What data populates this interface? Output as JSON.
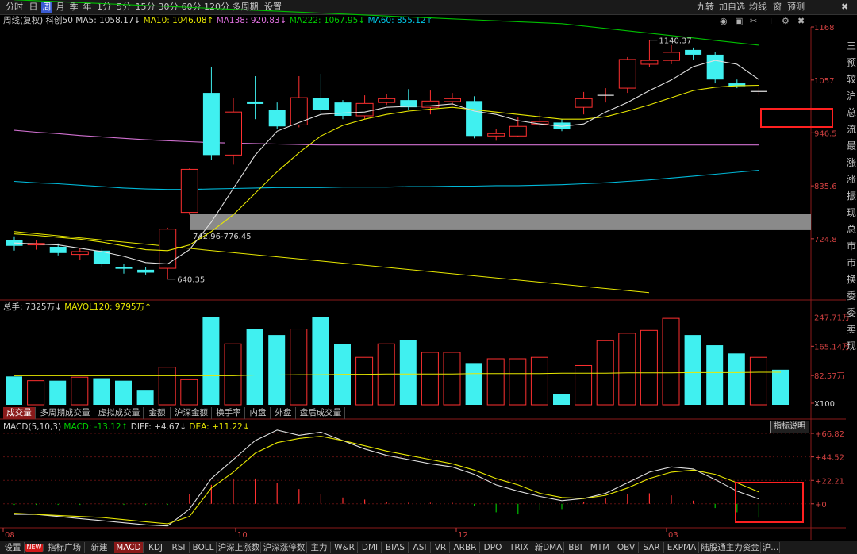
{
  "toolbar": {
    "periods": [
      "分时",
      "日",
      "周",
      "月",
      "季",
      "年",
      "1分",
      "5分",
      "15分",
      "30分",
      "60分",
      "120分",
      "多周期",
      "设置"
    ],
    "selected": "周",
    "right_items": [
      "九转",
      "加自选",
      "均线",
      "窗",
      "预测"
    ]
  },
  "kline_info": {
    "period": "周线(复权)",
    "name": "科创50",
    "ma5": "MA5: 1058.17↓",
    "ma10": "MA10: 1046.08↑",
    "ma138": "MA138: 920.83↓",
    "ma222": "MA222: 1067.95↓",
    "ma60": "MA60: 855.12↑"
  },
  "volume_info": {
    "total": "总手: 7325万↓",
    "mavol": "MAVOL120: 9795万↑"
  },
  "macd_info": {
    "name": "MACD(5,10,3)",
    "macd": "MACD: -13.12↑",
    "diff": "DIFF: +4.67↓",
    "dea": "DEA: +11.22↓"
  },
  "macd_button": "指标说明",
  "sub_tabs": [
    "成交量",
    "多周期成交量",
    "虚拟成交量",
    "金额",
    "沪深金额",
    "换手率",
    "内盘",
    "外盘",
    "盘后成交量"
  ],
  "sub_tab_selected": "成交量",
  "bottom_tabs": [
    "设置",
    "NEW",
    "指标广场",
    "新建",
    "MACD",
    "KDJ",
    "RSI",
    "BOLL",
    "沪深上涨数",
    "沪深涨停数",
    "主力",
    "W&R",
    "DMI",
    "BIAS",
    "ASI",
    "VR",
    "ARBR",
    "DPO",
    "TRIX",
    "新DMA",
    "BBI",
    "MTM",
    "OBV",
    "SAR",
    "EXPMA",
    "陆股通主力资金",
    "沪..."
  ],
  "bottom_selected": "MACD",
  "right_column": [
    "三",
    "预",
    "较",
    "沪",
    "总",
    "流",
    "最",
    "涨",
    "涨",
    "振",
    "现",
    "总",
    "市",
    "市",
    "换",
    "委",
    "委",
    "卖",
    "现"
  ],
  "colors": {
    "up": "#ff3030",
    "down": "#40f0f0",
    "ma5": "#e0e0e0",
    "ma10": "#e8e800",
    "ma138": "#d070d0",
    "ma222": "#00c000",
    "ma60": "#00b8d8",
    "bg": "#000000"
  },
  "chart_data": [
    {
      "type": "candlestick",
      "x_labels": [
        "08",
        "10",
        "12",
        "03"
      ],
      "y_ticks": [
        "1168",
        "1057",
        "946.5",
        "835.6",
        "724.8"
      ],
      "annotations": {
        "high": "1140.37",
        "low": "640.35",
        "range": "742.96-776.45"
      },
      "candles": [
        {
          "o": 722,
          "c": 710,
          "h": 730,
          "l": 700
        },
        {
          "o": 712,
          "c": 715,
          "h": 722,
          "l": 702
        },
        {
          "o": 708,
          "c": 695,
          "h": 715,
          "l": 690
        },
        {
          "o": 692,
          "c": 698,
          "h": 705,
          "l": 680
        },
        {
          "o": 700,
          "c": 672,
          "h": 705,
          "l": 665
        },
        {
          "o": 665,
          "c": 662,
          "h": 672,
          "l": 652
        },
        {
          "o": 660,
          "c": 654,
          "h": 665,
          "l": 650
        },
        {
          "o": 663,
          "c": 745,
          "h": 748,
          "l": 640.35
        },
        {
          "o": 780,
          "c": 870,
          "h": 872,
          "l": 775
        },
        {
          "o": 1030,
          "c": 900,
          "h": 1085,
          "l": 890
        },
        {
          "o": 900,
          "c": 990,
          "h": 1020,
          "l": 880
        },
        {
          "o": 1012,
          "c": 1007,
          "h": 1065,
          "l": 975
        },
        {
          "o": 995,
          "c": 960,
          "h": 1010,
          "l": 955
        },
        {
          "o": 963,
          "c": 1020,
          "h": 1065,
          "l": 958
        },
        {
          "o": 1020,
          "c": 995,
          "h": 1070,
          "l": 985
        },
        {
          "o": 1010,
          "c": 982,
          "h": 1015,
          "l": 975
        },
        {
          "o": 982,
          "c": 1008,
          "h": 1025,
          "l": 975
        },
        {
          "o": 1010,
          "c": 1018,
          "h": 1028,
          "l": 1005
        },
        {
          "o": 1015,
          "c": 1000,
          "h": 1038,
          "l": 995
        },
        {
          "o": 1000,
          "c": 1013,
          "h": 1035,
          "l": 985
        },
        {
          "o": 1012,
          "c": 1018,
          "h": 1030,
          "l": 1005
        },
        {
          "o": 1013,
          "c": 940,
          "h": 1023,
          "l": 935
        },
        {
          "o": 940,
          "c": 945,
          "h": 955,
          "l": 930
        },
        {
          "o": 940,
          "c": 960,
          "h": 980,
          "l": 938
        },
        {
          "o": 965,
          "c": 970,
          "h": 990,
          "l": 958
        },
        {
          "o": 968,
          "c": 955,
          "h": 975,
          "l": 950
        },
        {
          "o": 1000,
          "c": 1018,
          "h": 1032,
          "l": 985
        },
        {
          "o": 1025,
          "c": 1025,
          "h": 1040,
          "l": 1010
        },
        {
          "o": 1040,
          "c": 1100,
          "h": 1105,
          "l": 1030
        },
        {
          "o": 1090,
          "c": 1098,
          "h": 1140.37,
          "l": 1085
        },
        {
          "o": 1098,
          "c": 1115,
          "h": 1130,
          "l": 1090
        },
        {
          "o": 1120,
          "c": 1110,
          "h": 1125,
          "l": 1100
        },
        {
          "o": 1110,
          "c": 1058,
          "h": 1115,
          "l": 1050
        },
        {
          "o": 1050,
          "c": 1044,
          "h": 1058,
          "l": 1040
        },
        {
          "o": 1033,
          "c": 1033,
          "h": 1043,
          "l": 1025
        }
      ],
      "ma5": [
        716,
        714,
        712,
        705,
        698,
        688,
        675,
        672,
        702,
        760,
        830,
        900,
        950,
        968,
        985,
        988,
        990,
        1000,
        1002,
        1003,
        1007,
        992,
        985,
        972,
        965,
        960,
        965,
        990,
        1010,
        1035,
        1057,
        1085,
        1098,
        1090,
        1058
      ],
      "ma10": [
        735,
        732,
        728,
        724,
        718,
        710,
        702,
        700,
        712,
        740,
        775,
        820,
        865,
        905,
        940,
        962,
        975,
        985,
        992,
        996,
        1000,
        995,
        990,
        985,
        980,
        975,
        975,
        980,
        992,
        1005,
        1020,
        1035,
        1042,
        1045,
        1046
      ],
      "ma138": [
        952,
        948,
        945,
        941,
        938,
        935,
        932,
        930,
        928,
        926,
        925,
        924,
        923,
        922,
        921,
        921,
        921,
        921,
        921,
        921,
        921,
        921,
        921,
        921,
        921,
        921,
        921,
        921,
        921,
        921,
        921,
        921,
        921,
        921,
        921
      ],
      "ma222": [
        1225,
        1223,
        1221,
        1219,
        1217,
        1215,
        1213,
        1211,
        1209,
        1207,
        1205,
        1203,
        1201,
        1199,
        1197,
        1195,
        1193,
        1191,
        1189,
        1187,
        1185,
        1183,
        1181,
        1179,
        1177,
        1175,
        1170,
        1165,
        1160,
        1155,
        1150,
        1145,
        1140,
        1135,
        1130
      ],
      "ma60": [
        845,
        842,
        840,
        837,
        834,
        831,
        829,
        828,
        828,
        829,
        830,
        831,
        832,
        832,
        832,
        833,
        833,
        833,
        834,
        834,
        835,
        835,
        836,
        836,
        837,
        838,
        840,
        842,
        845,
        848,
        852,
        856,
        860,
        864,
        868
      ],
      "dash_line": [
        [
          0,
          740
        ],
        [
          13.5,
          705
        ]
      ],
      "price_range": {
        "y_top": 1168,
        "y_bottom": 600
      }
    },
    {
      "type": "bar",
      "name": "volume",
      "y_ticks": [
        "247.71万",
        "165.14万",
        "82.57万",
        "X100"
      ],
      "values": [
        80,
        68,
        68,
        78,
        75,
        68,
        40,
        106,
        71,
        248,
        172,
        214,
        197,
        214,
        248,
        172,
        134,
        172,
        183,
        148,
        148,
        118,
        130,
        130,
        134,
        30,
        111,
        181,
        202,
        210,
        244,
        197,
        168,
        145,
        134,
        99
      ],
      "mavol": [
        82,
        82,
        82,
        82,
        82,
        82,
        82,
        82,
        82,
        82,
        82,
        84,
        84,
        85,
        85,
        86,
        86,
        87,
        87,
        87,
        87,
        88,
        88,
        88,
        88,
        89,
        89,
        89,
        90,
        90,
        90,
        91,
        91,
        91,
        92,
        92
      ],
      "ylim": [
        0,
        260
      ]
    },
    {
      "type": "line",
      "name": "MACD",
      "y_ticks": [
        "+66.82",
        "+44.52",
        "+22.21",
        "+0"
      ],
      "diff": [
        -10,
        -10,
        -12,
        -14,
        -16,
        -18,
        -20,
        -21,
        -5,
        24,
        42,
        60,
        70,
        65,
        68,
        60,
        52,
        46,
        42,
        38,
        35,
        28,
        18,
        12,
        7,
        3,
        5,
        10,
        20,
        30,
        35,
        33,
        23,
        12,
        4.67
      ],
      "dea": [
        -9,
        -10,
        -11,
        -12,
        -13,
        -15,
        -17,
        -19,
        -12,
        15,
        30,
        48,
        58,
        62,
        64,
        60,
        55,
        50,
        46,
        42,
        38,
        32,
        24,
        18,
        10,
        6,
        5,
        8,
        15,
        24,
        30,
        32,
        28,
        20,
        11.22
      ],
      "macd_bars": [
        -1,
        -1,
        -1,
        -1,
        -1,
        -1,
        -1,
        -1,
        9,
        18,
        24,
        24,
        20,
        14,
        9,
        6,
        4,
        2,
        1,
        1,
        1,
        -2,
        -8,
        -10,
        -6,
        -5,
        2,
        5,
        9,
        10,
        8,
        3,
        -4,
        -8,
        -13.12
      ]
    }
  ]
}
